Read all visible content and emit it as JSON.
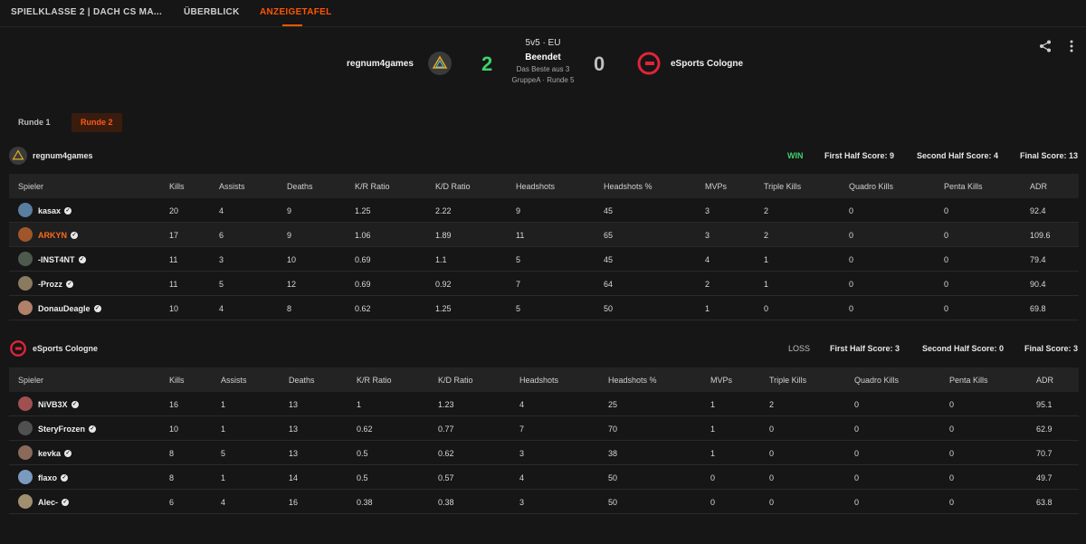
{
  "tabs": [
    {
      "label": "SPIELKLASSE 2 | DACH CS MA..."
    },
    {
      "label": "ÜBERBLICK"
    },
    {
      "label": "ANZEIGETAFEL"
    }
  ],
  "match": {
    "team1": "regnum4games",
    "team2": "eSports Cologne",
    "score1": "2",
    "score2": "0",
    "format": "5v5 · EU",
    "status": "Beendet",
    "best_of": "Das Beste aus 3",
    "group": "GruppeA · Runde 5"
  },
  "rounds": [
    {
      "label": "Runde 1"
    },
    {
      "label": "Runde 2"
    }
  ],
  "columns": [
    "Spieler",
    "Kills",
    "Assists",
    "Deaths",
    "K/R Ratio",
    "K/D Ratio",
    "Headshots",
    "Headshots %",
    "MVPs",
    "Triple Kills",
    "Quadro Kills",
    "Penta Kills",
    "ADR"
  ],
  "teams": [
    {
      "name": "regnum4games",
      "result": "WIN",
      "first_half": "First Half Score: 9",
      "second_half": "Second Half Score: 4",
      "final": "Final Score: 13",
      "players": [
        {
          "name": "kasax",
          "stats": [
            "20",
            "4",
            "9",
            "1.25",
            "2.22",
            "9",
            "45",
            "3",
            "2",
            "0",
            "0",
            "92.4"
          ]
        },
        {
          "name": "ARKYN",
          "stats": [
            "17",
            "6",
            "9",
            "1.06",
            "1.89",
            "11",
            "65",
            "3",
            "2",
            "0",
            "0",
            "109.6"
          ]
        },
        {
          "name": "-INST4NT",
          "stats": [
            "11",
            "3",
            "10",
            "0.69",
            "1.1",
            "5",
            "45",
            "4",
            "1",
            "0",
            "0",
            "79.4"
          ]
        },
        {
          "name": "-Prozz",
          "stats": [
            "11",
            "5",
            "12",
            "0.69",
            "0.92",
            "7",
            "64",
            "2",
            "1",
            "0",
            "0",
            "90.4"
          ]
        },
        {
          "name": "DonauDeagle",
          "stats": [
            "10",
            "4",
            "8",
            "0.62",
            "1.25",
            "5",
            "50",
            "1",
            "0",
            "0",
            "0",
            "69.8"
          ]
        }
      ]
    },
    {
      "name": "eSports Cologne",
      "result": "LOSS",
      "first_half": "First Half Score: 3",
      "second_half": "Second Half Score: 0",
      "final": "Final Score: 3",
      "players": [
        {
          "name": "NiVB3X",
          "stats": [
            "16",
            "1",
            "13",
            "1",
            "1.23",
            "4",
            "25",
            "1",
            "2",
            "0",
            "0",
            "95.1"
          ]
        },
        {
          "name": "SteryFrozen",
          "stats": [
            "10",
            "1",
            "13",
            "0.62",
            "0.77",
            "7",
            "70",
            "1",
            "0",
            "0",
            "0",
            "62.9"
          ]
        },
        {
          "name": "kevka",
          "stats": [
            "8",
            "5",
            "13",
            "0.5",
            "0.62",
            "3",
            "38",
            "1",
            "0",
            "0",
            "0",
            "70.7"
          ]
        },
        {
          "name": "flaxo",
          "stats": [
            "8",
            "1",
            "14",
            "0.5",
            "0.57",
            "4",
            "50",
            "0",
            "0",
            "0",
            "0",
            "49.7"
          ]
        },
        {
          "name": "Alec-",
          "stats": [
            "6",
            "4",
            "16",
            "0.38",
            "0.38",
            "3",
            "50",
            "0",
            "0",
            "0",
            "0",
            "63.8"
          ]
        }
      ]
    }
  ],
  "colors": {
    "accent": "#ff5500",
    "win": "#3fd16b",
    "background": "#161616"
  },
  "icons": [
    "share-icon",
    "more-vertical-icon",
    "verified-icon"
  ]
}
